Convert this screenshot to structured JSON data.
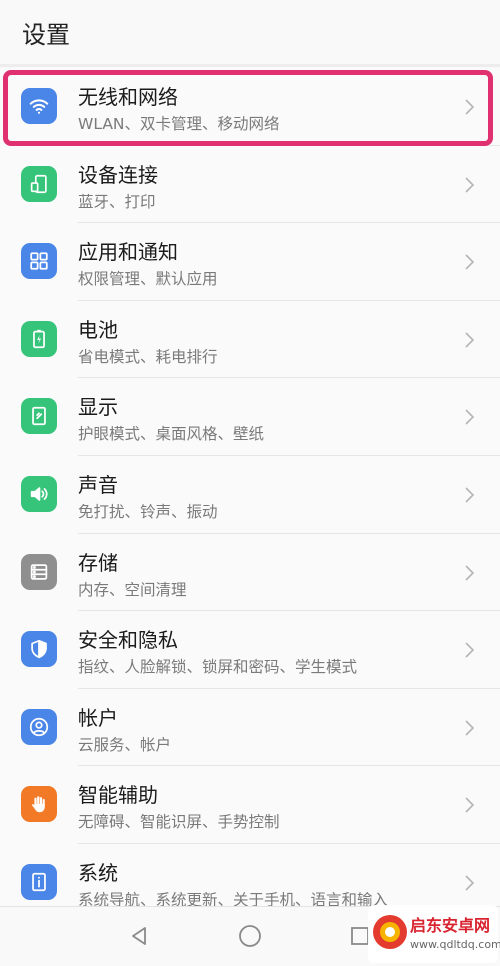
{
  "header": {
    "title": "设置"
  },
  "settings": [
    {
      "label": "无线和网络",
      "sub": "WLAN、双卡管理、移动网络",
      "icon": "wifi-icon",
      "color": "#4a86e8"
    },
    {
      "label": "设备连接",
      "sub": "蓝牙、打印",
      "icon": "device-connection-icon",
      "color": "#35c47a"
    },
    {
      "label": "应用和通知",
      "sub": "权限管理、默认应用",
      "icon": "apps-grid-icon",
      "color": "#4a86e8"
    },
    {
      "label": "电池",
      "sub": "省电模式、耗电排行",
      "icon": "battery-icon",
      "color": "#35c47a"
    },
    {
      "label": "显示",
      "sub": "护眼模式、桌面风格、壁纸",
      "icon": "display-icon",
      "color": "#35c47a"
    },
    {
      "label": "声音",
      "sub": "免打扰、铃声、振动",
      "icon": "speaker-icon",
      "color": "#35c47a"
    },
    {
      "label": "存储",
      "sub": "内存、空间清理",
      "icon": "storage-icon",
      "color": "#8f8f8f"
    },
    {
      "label": "安全和隐私",
      "sub": "指纹、人脸解锁、锁屏和密码、学生模式",
      "icon": "shield-icon",
      "color": "#4a86e8"
    },
    {
      "label": "帐户",
      "sub": "云服务、帐户",
      "icon": "account-icon",
      "color": "#4a86e8"
    },
    {
      "label": "智能辅助",
      "sub": "无障碍、智能识屏、手势控制",
      "icon": "hand-icon",
      "color": "#f27a26"
    },
    {
      "label": "系统",
      "sub": "系统导航、系统更新、关于手机、语言和输入",
      "icon": "system-info-icon",
      "color": "#4a86e8"
    }
  ],
  "highlight_color": "#e0306f",
  "watermark": {
    "title": "启东安卓网",
    "url": "www.qdltdq.com"
  }
}
